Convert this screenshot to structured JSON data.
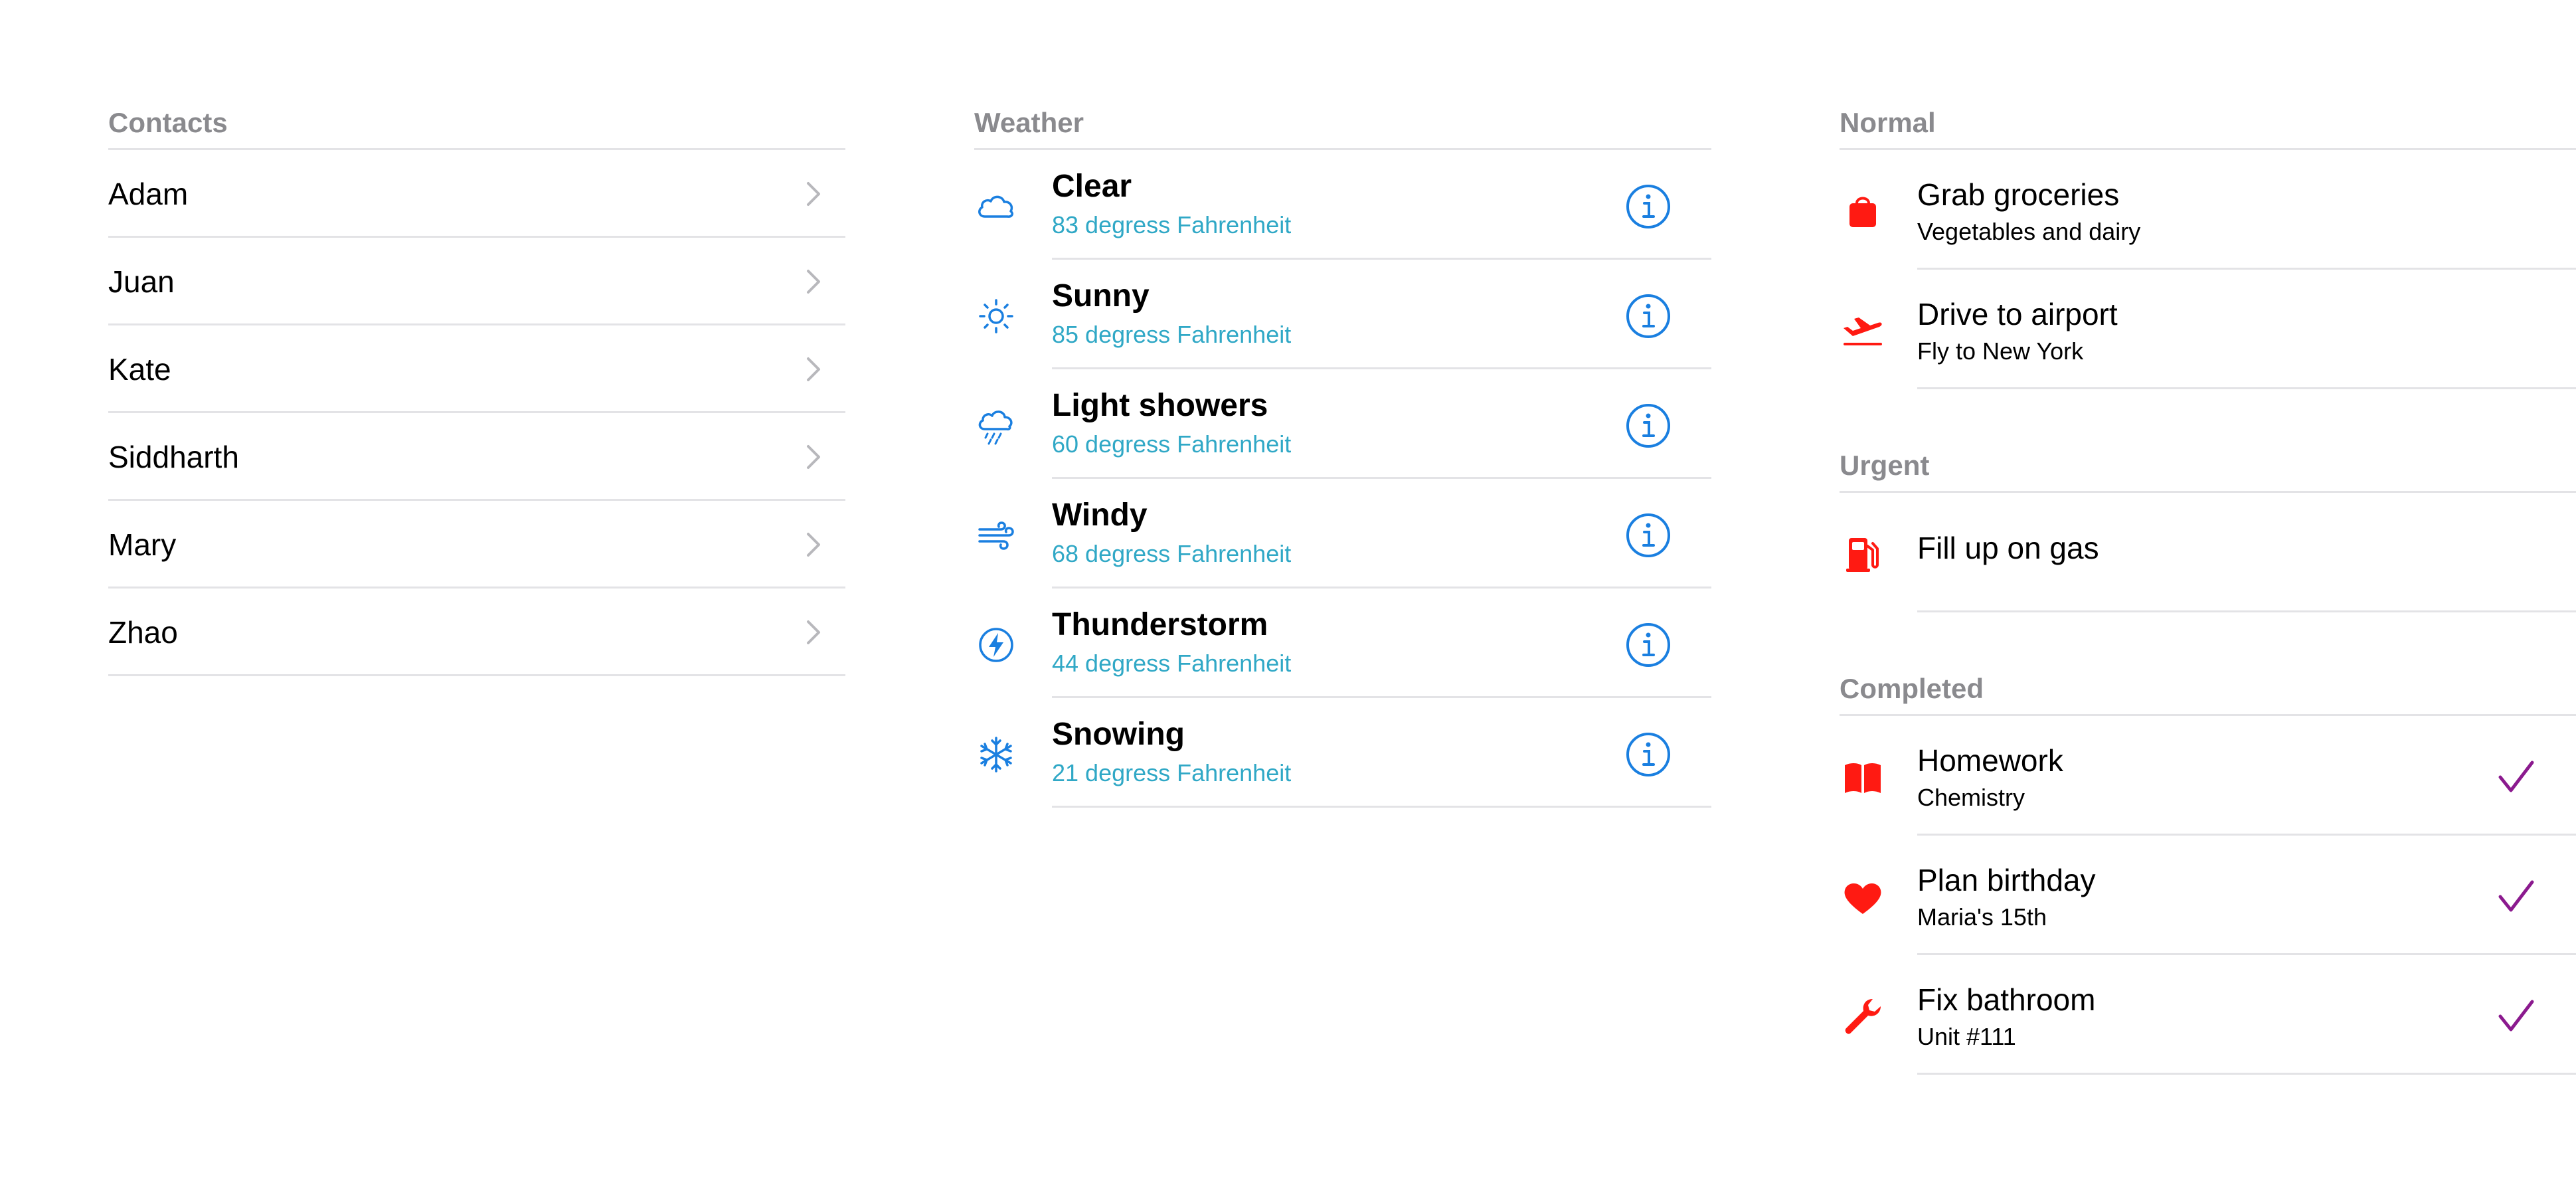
{
  "contacts": {
    "header": "Contacts",
    "items": [
      {
        "name": "Adam"
      },
      {
        "name": "Juan"
      },
      {
        "name": "Kate"
      },
      {
        "name": "Siddharth"
      },
      {
        "name": "Mary"
      },
      {
        "name": "Zhao"
      }
    ],
    "chevron_icon": "chevron-right-icon"
  },
  "weather": {
    "header": "Weather",
    "items": [
      {
        "title": "Clear",
        "subtitle": "83 degress Fahrenheit",
        "icon": "cloud-icon"
      },
      {
        "title": "Sunny",
        "subtitle": "85 degress Fahrenheit",
        "icon": "sun-icon"
      },
      {
        "title": "Light showers",
        "subtitle": "60 degress Fahrenheit",
        "icon": "cloud-drizzle-icon"
      },
      {
        "title": "Windy",
        "subtitle": "68 degress Fahrenheit",
        "icon": "wind-icon"
      },
      {
        "title": "Thunderstorm",
        "subtitle": "44 degress Fahrenheit",
        "icon": "bolt-circle-icon"
      },
      {
        "title": "Snowing",
        "subtitle": "21 degress Fahrenheit",
        "icon": "snowflake-icon"
      }
    ],
    "accessory_icon": "info-circle-icon",
    "colors": {
      "icon": "#1a7fe0",
      "subtitle": "#30a8c6"
    }
  },
  "tasks": {
    "sections": [
      {
        "header": "Normal",
        "items": [
          {
            "title": "Grab groceries",
            "subtitle": "Vegetables and dairy",
            "icon": "shopping-bag-icon",
            "completed": false
          },
          {
            "title": "Drive to airport",
            "subtitle": "Fly to New York",
            "icon": "airplane-departure-icon",
            "completed": false
          }
        ]
      },
      {
        "header": "Urgent",
        "items": [
          {
            "title": "Fill up on gas",
            "subtitle": "",
            "icon": "fuel-pump-icon",
            "completed": false
          }
        ]
      },
      {
        "header": "Completed",
        "items": [
          {
            "title": "Homework",
            "subtitle": "Chemistry",
            "icon": "book-icon",
            "completed": true
          },
          {
            "title": "Plan birthday",
            "subtitle": "Maria's 15th",
            "icon": "heart-icon",
            "completed": true
          },
          {
            "title": "Fix bathroom",
            "subtitle": "Unit #111",
            "icon": "wrench-icon",
            "completed": true
          }
        ]
      }
    ],
    "colors": {
      "icon": "#ff1a12",
      "checkmark": "#8b1a8e"
    }
  }
}
